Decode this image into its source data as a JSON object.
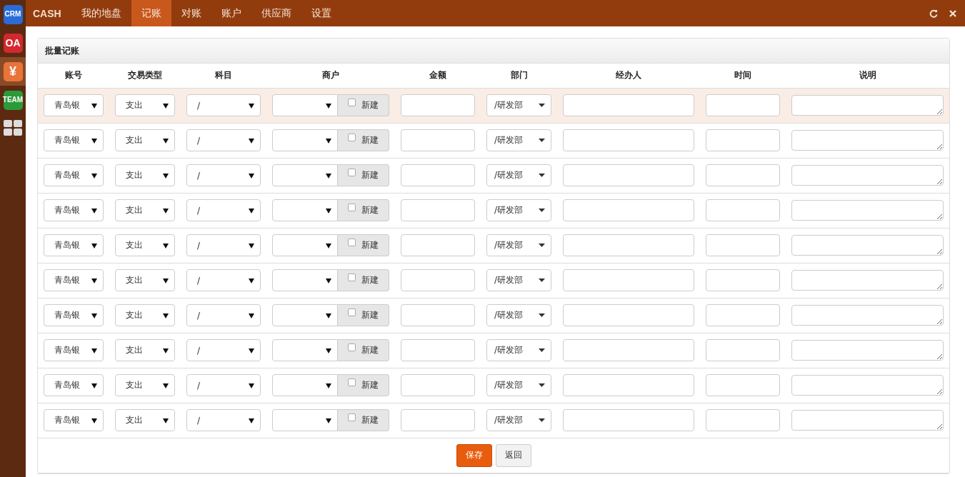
{
  "sidebar": {
    "items": [
      {
        "kind": "crm",
        "label": "CRM",
        "selected": false
      },
      {
        "kind": "oa",
        "label": "OA",
        "selected": false
      },
      {
        "kind": "yen",
        "label": "¥",
        "selected": true
      },
      {
        "kind": "team",
        "label": "TEAM",
        "selected": false
      },
      {
        "kind": "grid",
        "selected": false
      }
    ]
  },
  "nav": {
    "brand": "CASH",
    "tabs": [
      {
        "label": "我的地盘",
        "selected": false
      },
      {
        "label": "记账",
        "selected": true
      },
      {
        "label": "对账",
        "selected": false
      },
      {
        "label": "账户",
        "selected": false
      },
      {
        "label": "供应商",
        "selected": false
      },
      {
        "label": "设置",
        "selected": false
      }
    ]
  },
  "panel": {
    "title": "批量记账",
    "columns": [
      "账号",
      "交易类型",
      "科目",
      "商户",
      "金额",
      "部门",
      "经办人",
      "时间",
      "说明"
    ],
    "rows": [
      {
        "account": "青岛银",
        "type": "支出",
        "subject": "/",
        "new_label": "新建",
        "new_checked": false,
        "dept": "/研发部",
        "highlighted": true
      },
      {
        "account": "青岛银",
        "type": "支出",
        "subject": "/",
        "new_label": "新建",
        "new_checked": false,
        "dept": "/研发部",
        "highlighted": false
      },
      {
        "account": "青岛银",
        "type": "支出",
        "subject": "/",
        "new_label": "新建",
        "new_checked": false,
        "dept": "/研发部",
        "highlighted": false
      },
      {
        "account": "青岛银",
        "type": "支出",
        "subject": "/",
        "new_label": "新建",
        "new_checked": false,
        "dept": "/研发部",
        "highlighted": false
      },
      {
        "account": "青岛银",
        "type": "支出",
        "subject": "/",
        "new_label": "新建",
        "new_checked": false,
        "dept": "/研发部",
        "highlighted": false
      },
      {
        "account": "青岛银",
        "type": "支出",
        "subject": "/",
        "new_label": "新建",
        "new_checked": false,
        "dept": "/研发部",
        "highlighted": false
      },
      {
        "account": "青岛银",
        "type": "支出",
        "subject": "/",
        "new_label": "新建",
        "new_checked": false,
        "dept": "/研发部",
        "highlighted": false
      },
      {
        "account": "青岛银",
        "type": "支出",
        "subject": "/",
        "new_label": "新建",
        "new_checked": false,
        "dept": "/研发部",
        "highlighted": false
      },
      {
        "account": "青岛银",
        "type": "支出",
        "subject": "/",
        "new_label": "新建",
        "new_checked": false,
        "dept": "/研发部",
        "highlighted": false
      },
      {
        "account": "青岛银",
        "type": "支出",
        "subject": "/",
        "new_label": "新建",
        "new_checked": false,
        "dept": "/研发部",
        "highlighted": false
      }
    ],
    "buttons": [
      {
        "label": "保存",
        "kind": "primary"
      },
      {
        "label": "返回",
        "kind": "default"
      }
    ]
  }
}
